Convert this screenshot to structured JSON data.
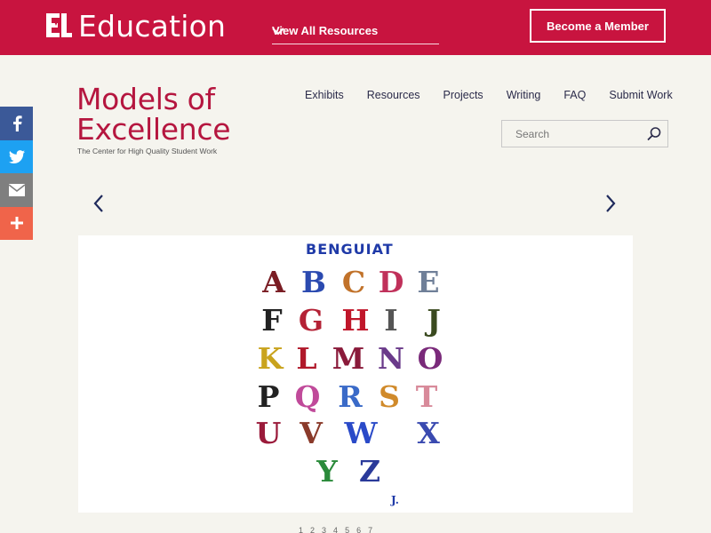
{
  "topbar": {
    "logo_text": "Education",
    "resources_label": "View All Resources",
    "member_label": "Become a Member",
    "colors": {
      "background": "#c8143f",
      "text": "#ffffff"
    }
  },
  "social": [
    {
      "name": "facebook",
      "icon": "facebook-icon",
      "color": "#3b5998"
    },
    {
      "name": "twitter",
      "icon": "twitter-icon",
      "color": "#1da1f2"
    },
    {
      "name": "email",
      "icon": "envelope-icon",
      "color": "#7f7f7f"
    },
    {
      "name": "more",
      "icon": "plus-icon",
      "color": "#f0644a"
    }
  ],
  "brand": {
    "line1": "Models of",
    "line2": "Excellence",
    "tagline": "The Center for High Quality Student Work",
    "color": "#b5163f"
  },
  "nav": [
    "Exhibits",
    "Resources",
    "Projects",
    "Writing",
    "FAQ",
    "Submit Work"
  ],
  "search": {
    "placeholder": "Search"
  },
  "artwork": {
    "title": "BENGUIAT",
    "rows": [
      [
        "A",
        "B",
        "C",
        "D",
        "E"
      ],
      [
        "F",
        "G",
        "H",
        "I",
        "J"
      ],
      [
        "K",
        "L",
        "M",
        "N",
        "O"
      ],
      [
        "P",
        "Q",
        "R",
        "S",
        "T"
      ],
      [
        "U",
        "V",
        "W",
        "X"
      ],
      [
        "Y",
        "Z"
      ]
    ],
    "signature": "J."
  },
  "carousel": {
    "pages": [
      "1",
      "2",
      "3",
      "4",
      "5",
      "6",
      "7"
    ]
  }
}
